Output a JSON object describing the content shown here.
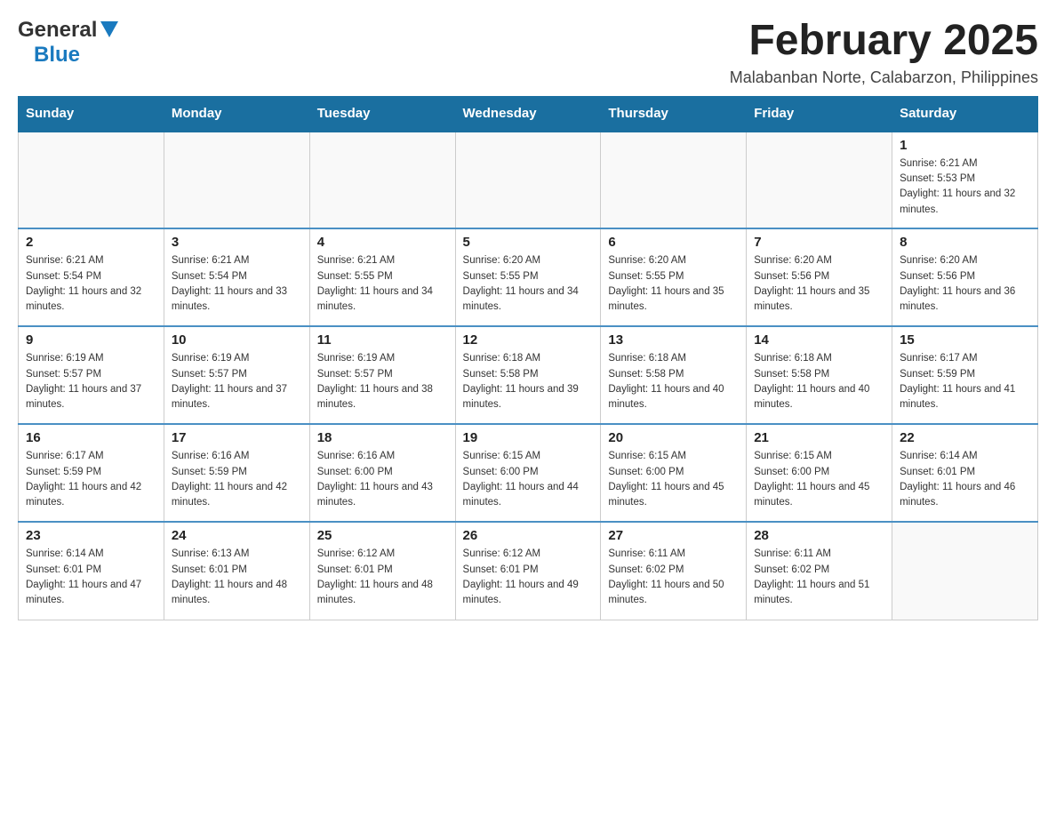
{
  "header": {
    "logo": {
      "text_general": "General",
      "text_blue": "Blue",
      "alt": "GeneralBlue Logo"
    },
    "month_title": "February 2025",
    "location": "Malabanban Norte, Calabarzon, Philippines"
  },
  "calendar": {
    "days_of_week": [
      "Sunday",
      "Monday",
      "Tuesday",
      "Wednesday",
      "Thursday",
      "Friday",
      "Saturday"
    ],
    "weeks": [
      [
        {
          "day": "",
          "info": ""
        },
        {
          "day": "",
          "info": ""
        },
        {
          "day": "",
          "info": ""
        },
        {
          "day": "",
          "info": ""
        },
        {
          "day": "",
          "info": ""
        },
        {
          "day": "",
          "info": ""
        },
        {
          "day": "1",
          "info": "Sunrise: 6:21 AM\nSunset: 5:53 PM\nDaylight: 11 hours and 32 minutes."
        }
      ],
      [
        {
          "day": "2",
          "info": "Sunrise: 6:21 AM\nSunset: 5:54 PM\nDaylight: 11 hours and 32 minutes."
        },
        {
          "day": "3",
          "info": "Sunrise: 6:21 AM\nSunset: 5:54 PM\nDaylight: 11 hours and 33 minutes."
        },
        {
          "day": "4",
          "info": "Sunrise: 6:21 AM\nSunset: 5:55 PM\nDaylight: 11 hours and 34 minutes."
        },
        {
          "day": "5",
          "info": "Sunrise: 6:20 AM\nSunset: 5:55 PM\nDaylight: 11 hours and 34 minutes."
        },
        {
          "day": "6",
          "info": "Sunrise: 6:20 AM\nSunset: 5:55 PM\nDaylight: 11 hours and 35 minutes."
        },
        {
          "day": "7",
          "info": "Sunrise: 6:20 AM\nSunset: 5:56 PM\nDaylight: 11 hours and 35 minutes."
        },
        {
          "day": "8",
          "info": "Sunrise: 6:20 AM\nSunset: 5:56 PM\nDaylight: 11 hours and 36 minutes."
        }
      ],
      [
        {
          "day": "9",
          "info": "Sunrise: 6:19 AM\nSunset: 5:57 PM\nDaylight: 11 hours and 37 minutes."
        },
        {
          "day": "10",
          "info": "Sunrise: 6:19 AM\nSunset: 5:57 PM\nDaylight: 11 hours and 37 minutes."
        },
        {
          "day": "11",
          "info": "Sunrise: 6:19 AM\nSunset: 5:57 PM\nDaylight: 11 hours and 38 minutes."
        },
        {
          "day": "12",
          "info": "Sunrise: 6:18 AM\nSunset: 5:58 PM\nDaylight: 11 hours and 39 minutes."
        },
        {
          "day": "13",
          "info": "Sunrise: 6:18 AM\nSunset: 5:58 PM\nDaylight: 11 hours and 40 minutes."
        },
        {
          "day": "14",
          "info": "Sunrise: 6:18 AM\nSunset: 5:58 PM\nDaylight: 11 hours and 40 minutes."
        },
        {
          "day": "15",
          "info": "Sunrise: 6:17 AM\nSunset: 5:59 PM\nDaylight: 11 hours and 41 minutes."
        }
      ],
      [
        {
          "day": "16",
          "info": "Sunrise: 6:17 AM\nSunset: 5:59 PM\nDaylight: 11 hours and 42 minutes."
        },
        {
          "day": "17",
          "info": "Sunrise: 6:16 AM\nSunset: 5:59 PM\nDaylight: 11 hours and 42 minutes."
        },
        {
          "day": "18",
          "info": "Sunrise: 6:16 AM\nSunset: 6:00 PM\nDaylight: 11 hours and 43 minutes."
        },
        {
          "day": "19",
          "info": "Sunrise: 6:15 AM\nSunset: 6:00 PM\nDaylight: 11 hours and 44 minutes."
        },
        {
          "day": "20",
          "info": "Sunrise: 6:15 AM\nSunset: 6:00 PM\nDaylight: 11 hours and 45 minutes."
        },
        {
          "day": "21",
          "info": "Sunrise: 6:15 AM\nSunset: 6:00 PM\nDaylight: 11 hours and 45 minutes."
        },
        {
          "day": "22",
          "info": "Sunrise: 6:14 AM\nSunset: 6:01 PM\nDaylight: 11 hours and 46 minutes."
        }
      ],
      [
        {
          "day": "23",
          "info": "Sunrise: 6:14 AM\nSunset: 6:01 PM\nDaylight: 11 hours and 47 minutes."
        },
        {
          "day": "24",
          "info": "Sunrise: 6:13 AM\nSunset: 6:01 PM\nDaylight: 11 hours and 48 minutes."
        },
        {
          "day": "25",
          "info": "Sunrise: 6:12 AM\nSunset: 6:01 PM\nDaylight: 11 hours and 48 minutes."
        },
        {
          "day": "26",
          "info": "Sunrise: 6:12 AM\nSunset: 6:01 PM\nDaylight: 11 hours and 49 minutes."
        },
        {
          "day": "27",
          "info": "Sunrise: 6:11 AM\nSunset: 6:02 PM\nDaylight: 11 hours and 50 minutes."
        },
        {
          "day": "28",
          "info": "Sunrise: 6:11 AM\nSunset: 6:02 PM\nDaylight: 11 hours and 51 minutes."
        },
        {
          "day": "",
          "info": ""
        }
      ]
    ]
  }
}
